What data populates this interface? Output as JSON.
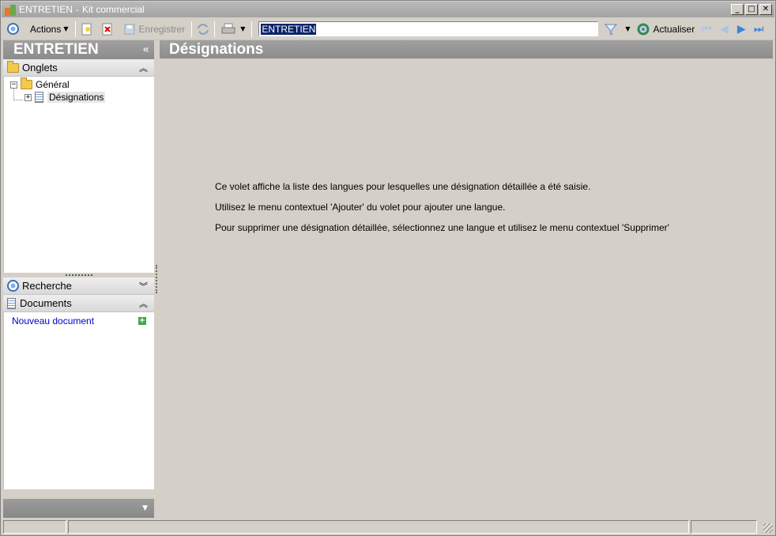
{
  "window": {
    "title": "ENTRETIEN",
    "separator": "-",
    "subtitle": "Kit commercial",
    "minimize": "_",
    "maximize": "□",
    "close": "✕"
  },
  "toolbar": {
    "actions_label": "Actions",
    "save_label": "Enregistrer",
    "search_value": "ENTRETIEN",
    "refresh_label": "Actualiser"
  },
  "left": {
    "header": "ENTRETIEN",
    "collapse_glyph": "«",
    "tabs_section": "Onglets",
    "tree": {
      "root": "Général",
      "child": "Désignations"
    },
    "search_section": "Recherche",
    "documents_section": "Documents",
    "new_document": "Nouveau document"
  },
  "main": {
    "header": "Désignations",
    "messages": [
      "Ce volet affiche la liste des langues pour lesquelles une désignation détaillée a été saisie.",
      "Utilisez le menu contextuel 'Ajouter' du volet pour ajouter une langue.",
      "Pour supprimer une désignation détaillée, sélectionnez une langue et utilisez le menu contextuel 'Supprimer'"
    ]
  },
  "colors": {
    "header_gray": "#8c8c8c",
    "link_blue": "#0000cc",
    "selection": "#0a246a",
    "nav_blue": "#3c82d8"
  },
  "icons": [
    "app-icon",
    "circle-icon",
    "new-icon",
    "delete-icon",
    "save-icon",
    "sync-icon",
    "print-icon",
    "filter-icon",
    "refresh-icon",
    "first-icon",
    "prev-icon",
    "next-icon",
    "last-icon",
    "folder-icon",
    "doc-icon",
    "plus-icon"
  ]
}
